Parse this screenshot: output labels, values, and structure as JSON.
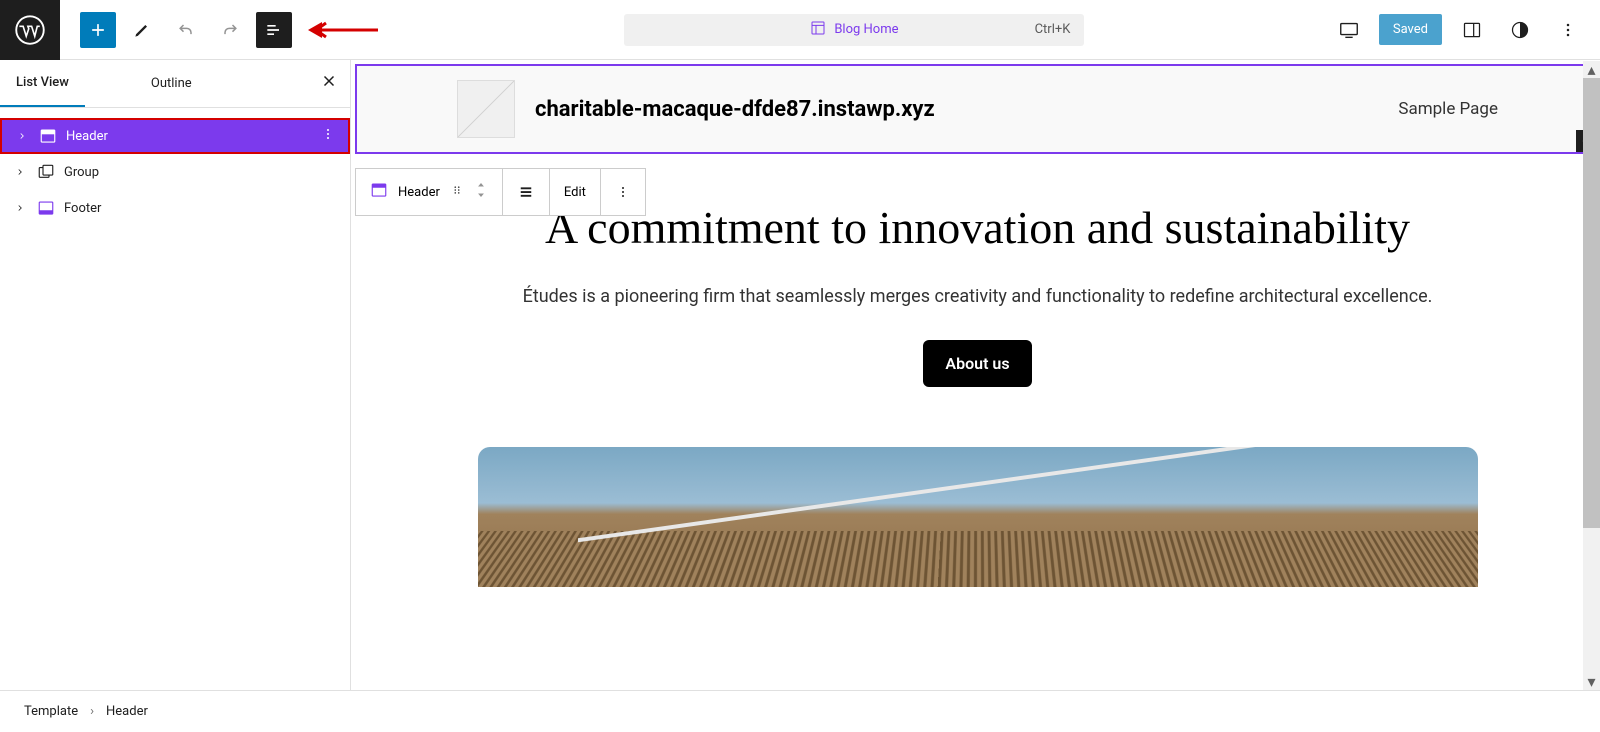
{
  "topbar": {
    "template_label": "Blog Home",
    "shortcut": "Ctrl+K",
    "saved_label": "Saved"
  },
  "sidebar": {
    "tabs": {
      "list_view": "List View",
      "outline": "Outline"
    },
    "items": [
      {
        "label": "Header"
      },
      {
        "label": "Group"
      },
      {
        "label": "Footer"
      }
    ]
  },
  "header_block": {
    "site_title": "charitable-macaque-dfde87.instawp.xyz",
    "nav_item": "Sample Page"
  },
  "floating_toolbar": {
    "block_name": "Header",
    "edit_label": "Edit"
  },
  "content": {
    "hero_title": "A commitment to innovation and sustainability",
    "hero_text": "Études is a pioneering firm that seamlessly merges creativity and functionality to redefine architectural excellence.",
    "about_button": "About us"
  },
  "breadcrumb": {
    "root": "Template",
    "current": "Header"
  }
}
